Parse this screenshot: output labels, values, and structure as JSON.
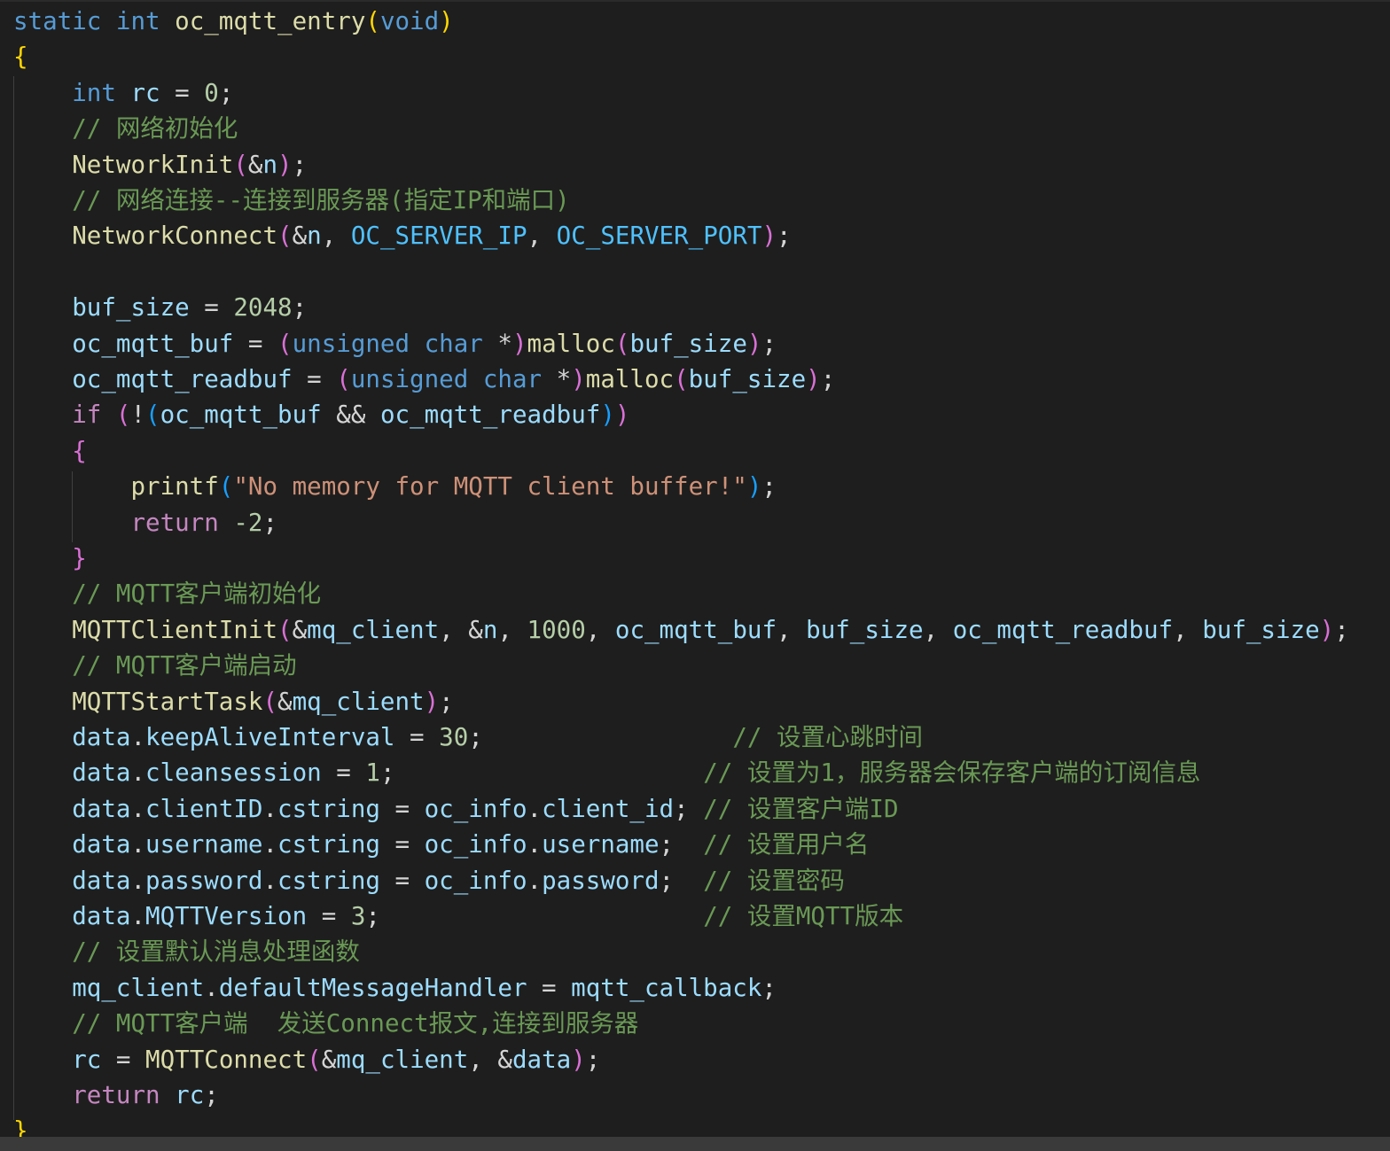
{
  "colors": {
    "background": "#1e1e1e",
    "keyword": "#569cd6",
    "control": "#c586c0",
    "function": "#dcdcaa",
    "variable": "#9cdcfe",
    "number": "#b5cea8",
    "string": "#ce9178",
    "comment": "#6a9955",
    "macro": "#4fc1ff",
    "bracket_1": "#ffd700",
    "bracket_2": "#da70d6",
    "bracket_3": "#179fff"
  },
  "code": {
    "lines": [
      [
        [
          "kw",
          "static"
        ],
        [
          "p",
          " "
        ],
        [
          "kw",
          "int"
        ],
        [
          "p",
          " "
        ],
        [
          "fn",
          "oc_mqtt_entry"
        ],
        [
          "br1",
          "("
        ],
        [
          "kw",
          "void"
        ],
        [
          "br1",
          ")"
        ]
      ],
      [
        [
          "br1",
          "{"
        ]
      ],
      [
        [
          "p",
          "    "
        ],
        [
          "kw",
          "int"
        ],
        [
          "p",
          " "
        ],
        [
          "var",
          "rc"
        ],
        [
          "p",
          " = "
        ],
        [
          "num",
          "0"
        ],
        [
          "p",
          ";"
        ]
      ],
      [
        [
          "p",
          "    "
        ],
        [
          "cmt",
          "// 网络初始化"
        ]
      ],
      [
        [
          "p",
          "    "
        ],
        [
          "fn",
          "NetworkInit"
        ],
        [
          "br2",
          "("
        ],
        [
          "p",
          "&"
        ],
        [
          "var",
          "n"
        ],
        [
          "br2",
          ")"
        ],
        [
          "p",
          ";"
        ]
      ],
      [
        [
          "p",
          "    "
        ],
        [
          "cmt",
          "// 网络连接--连接到服务器(指定IP和端口)"
        ]
      ],
      [
        [
          "p",
          "    "
        ],
        [
          "fn",
          "NetworkConnect"
        ],
        [
          "br2",
          "("
        ],
        [
          "p",
          "&"
        ],
        [
          "var",
          "n"
        ],
        [
          "p",
          ", "
        ],
        [
          "mac",
          "OC_SERVER_IP"
        ],
        [
          "p",
          ", "
        ],
        [
          "mac",
          "OC_SERVER_PORT"
        ],
        [
          "br2",
          ")"
        ],
        [
          "p",
          ";"
        ]
      ],
      [],
      [
        [
          "p",
          "    "
        ],
        [
          "var",
          "buf_size"
        ],
        [
          "p",
          " = "
        ],
        [
          "num",
          "2048"
        ],
        [
          "p",
          ";"
        ]
      ],
      [
        [
          "p",
          "    "
        ],
        [
          "var",
          "oc_mqtt_buf"
        ],
        [
          "p",
          " = "
        ],
        [
          "br2",
          "("
        ],
        [
          "kw",
          "unsigned"
        ],
        [
          "p",
          " "
        ],
        [
          "kw",
          "char"
        ],
        [
          "p",
          " *"
        ],
        [
          "br2",
          ")"
        ],
        [
          "fn",
          "malloc"
        ],
        [
          "br2",
          "("
        ],
        [
          "var",
          "buf_size"
        ],
        [
          "br2",
          ")"
        ],
        [
          "p",
          ";"
        ]
      ],
      [
        [
          "p",
          "    "
        ],
        [
          "var",
          "oc_mqtt_readbuf"
        ],
        [
          "p",
          " = "
        ],
        [
          "br2",
          "("
        ],
        [
          "kw",
          "unsigned"
        ],
        [
          "p",
          " "
        ],
        [
          "kw",
          "char"
        ],
        [
          "p",
          " *"
        ],
        [
          "br2",
          ")"
        ],
        [
          "fn",
          "malloc"
        ],
        [
          "br2",
          "("
        ],
        [
          "var",
          "buf_size"
        ],
        [
          "br2",
          ")"
        ],
        [
          "p",
          ";"
        ]
      ],
      [
        [
          "p",
          "    "
        ],
        [
          "ctl",
          "if"
        ],
        [
          "p",
          " "
        ],
        [
          "br2",
          "("
        ],
        [
          "p",
          "!"
        ],
        [
          "br3",
          "("
        ],
        [
          "var",
          "oc_mqtt_buf"
        ],
        [
          "p",
          " && "
        ],
        [
          "var",
          "oc_mqtt_readbuf"
        ],
        [
          "br3",
          ")"
        ],
        [
          "br2",
          ")"
        ]
      ],
      [
        [
          "p",
          "    "
        ],
        [
          "br2",
          "{"
        ]
      ],
      [
        [
          "p",
          "        "
        ],
        [
          "fn",
          "printf"
        ],
        [
          "br3",
          "("
        ],
        [
          "str",
          "\"No memory for MQTT client buffer!\""
        ],
        [
          "br3",
          ")"
        ],
        [
          "p",
          ";"
        ]
      ],
      [
        [
          "p",
          "        "
        ],
        [
          "ctl",
          "return"
        ],
        [
          "p",
          " "
        ],
        [
          "num",
          "-2"
        ],
        [
          "p",
          ";"
        ]
      ],
      [
        [
          "p",
          "    "
        ],
        [
          "br2",
          "}"
        ]
      ],
      [
        [
          "p",
          "    "
        ],
        [
          "cmt",
          "// MQTT客户端初始化"
        ]
      ],
      [
        [
          "p",
          "    "
        ],
        [
          "fn",
          "MQTTClientInit"
        ],
        [
          "br2",
          "("
        ],
        [
          "p",
          "&"
        ],
        [
          "var",
          "mq_client"
        ],
        [
          "p",
          ", &"
        ],
        [
          "var",
          "n"
        ],
        [
          "p",
          ", "
        ],
        [
          "num",
          "1000"
        ],
        [
          "p",
          ", "
        ],
        [
          "var",
          "oc_mqtt_buf"
        ],
        [
          "p",
          ", "
        ],
        [
          "var",
          "buf_size"
        ],
        [
          "p",
          ", "
        ],
        [
          "var",
          "oc_mqtt_readbuf"
        ],
        [
          "p",
          ", "
        ],
        [
          "var",
          "buf_size"
        ],
        [
          "br2",
          ")"
        ],
        [
          "p",
          ";"
        ]
      ],
      [
        [
          "p",
          "    "
        ],
        [
          "cmt",
          "// MQTT客户端启动"
        ]
      ],
      [
        [
          "p",
          "    "
        ],
        [
          "fn",
          "MQTTStartTask"
        ],
        [
          "br2",
          "("
        ],
        [
          "p",
          "&"
        ],
        [
          "var",
          "mq_client"
        ],
        [
          "br2",
          ")"
        ],
        [
          "p",
          ";"
        ]
      ],
      [
        [
          "p",
          "    "
        ],
        [
          "var",
          "data"
        ],
        [
          "p",
          "."
        ],
        [
          "var",
          "keepAliveInterval"
        ],
        [
          "p",
          " = "
        ],
        [
          "num",
          "30"
        ],
        [
          "p",
          ";                 "
        ],
        [
          "cmt",
          "// 设置心跳时间"
        ]
      ],
      [
        [
          "p",
          "    "
        ],
        [
          "var",
          "data"
        ],
        [
          "p",
          "."
        ],
        [
          "var",
          "cleansession"
        ],
        [
          "p",
          " = "
        ],
        [
          "num",
          "1"
        ],
        [
          "p",
          ";                     "
        ],
        [
          "cmt",
          "// 设置为1，服务器会保存客户端的订阅信息"
        ]
      ],
      [
        [
          "p",
          "    "
        ],
        [
          "var",
          "data"
        ],
        [
          "p",
          "."
        ],
        [
          "var",
          "clientID"
        ],
        [
          "p",
          "."
        ],
        [
          "var",
          "cstring"
        ],
        [
          "p",
          " = "
        ],
        [
          "var",
          "oc_info"
        ],
        [
          "p",
          "."
        ],
        [
          "var",
          "client_id"
        ],
        [
          "p",
          "; "
        ],
        [
          "cmt",
          "// 设置客户端ID"
        ]
      ],
      [
        [
          "p",
          "    "
        ],
        [
          "var",
          "data"
        ],
        [
          "p",
          "."
        ],
        [
          "var",
          "username"
        ],
        [
          "p",
          "."
        ],
        [
          "var",
          "cstring"
        ],
        [
          "p",
          " = "
        ],
        [
          "var",
          "oc_info"
        ],
        [
          "p",
          "."
        ],
        [
          "var",
          "username"
        ],
        [
          "p",
          ";  "
        ],
        [
          "cmt",
          "// 设置用户名"
        ]
      ],
      [
        [
          "p",
          "    "
        ],
        [
          "var",
          "data"
        ],
        [
          "p",
          "."
        ],
        [
          "var",
          "password"
        ],
        [
          "p",
          "."
        ],
        [
          "var",
          "cstring"
        ],
        [
          "p",
          " = "
        ],
        [
          "var",
          "oc_info"
        ],
        [
          "p",
          "."
        ],
        [
          "var",
          "password"
        ],
        [
          "p",
          ";  "
        ],
        [
          "cmt",
          "// 设置密码"
        ]
      ],
      [
        [
          "p",
          "    "
        ],
        [
          "var",
          "data"
        ],
        [
          "p",
          "."
        ],
        [
          "var",
          "MQTTVersion"
        ],
        [
          "p",
          " = "
        ],
        [
          "num",
          "3"
        ],
        [
          "p",
          ";                      "
        ],
        [
          "cmt",
          "// 设置MQTT版本"
        ]
      ],
      [
        [
          "p",
          "    "
        ],
        [
          "cmt",
          "// 设置默认消息处理函数"
        ]
      ],
      [
        [
          "p",
          "    "
        ],
        [
          "var",
          "mq_client"
        ],
        [
          "p",
          "."
        ],
        [
          "var",
          "defaultMessageHandler"
        ],
        [
          "p",
          " = "
        ],
        [
          "var",
          "mqtt_callback"
        ],
        [
          "p",
          ";"
        ]
      ],
      [
        [
          "p",
          "    "
        ],
        [
          "cmt",
          "// MQTT客户端  发送Connect报文,连接到服务器"
        ]
      ],
      [
        [
          "p",
          "    "
        ],
        [
          "var",
          "rc"
        ],
        [
          "p",
          " = "
        ],
        [
          "fn",
          "MQTTConnect"
        ],
        [
          "br2",
          "("
        ],
        [
          "p",
          "&"
        ],
        [
          "var",
          "mq_client"
        ],
        [
          "p",
          ", &"
        ],
        [
          "var",
          "data"
        ],
        [
          "br2",
          ")"
        ],
        [
          "p",
          ";"
        ]
      ],
      [
        [
          "p",
          "    "
        ],
        [
          "ctl",
          "return"
        ],
        [
          "p",
          " "
        ],
        [
          "var",
          "rc"
        ],
        [
          "p",
          ";"
        ]
      ],
      [
        [
          "br1",
          "}"
        ]
      ]
    ]
  }
}
